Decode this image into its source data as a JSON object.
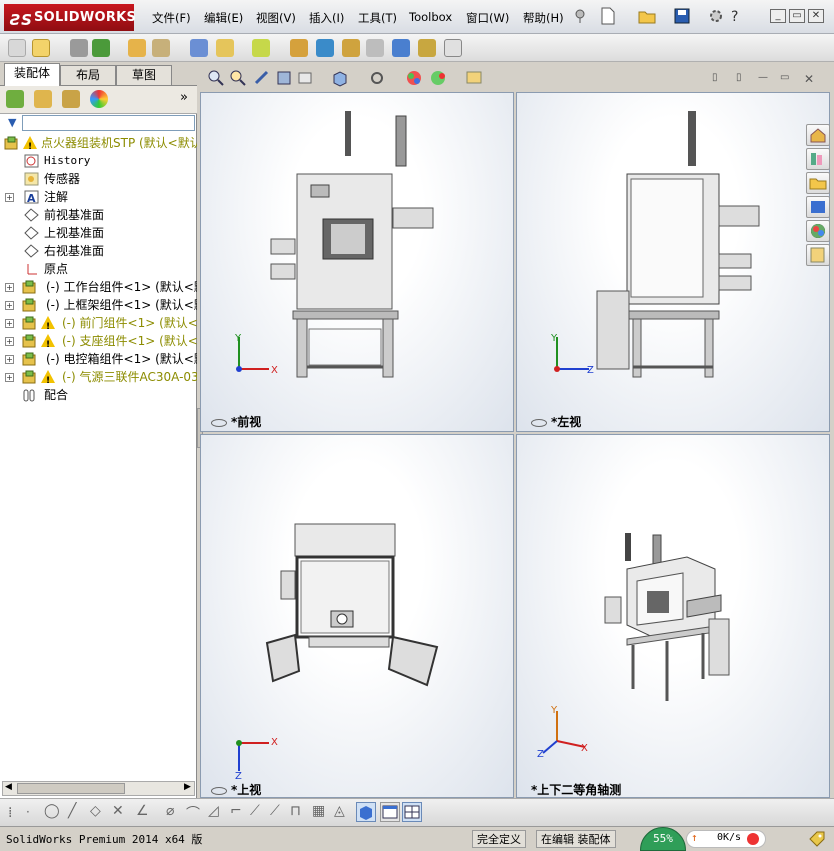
{
  "app": {
    "logo_text": "SOLIDWORKS",
    "logo_prefix": "3S"
  },
  "menu": [
    {
      "label": "文件(F)"
    },
    {
      "label": "编辑(E)"
    },
    {
      "label": "视图(V)"
    },
    {
      "label": "插入(I)"
    },
    {
      "label": "工具(T)"
    },
    {
      "label": "Toolbox"
    },
    {
      "label": "窗口(W)"
    },
    {
      "label": "帮助(H)"
    }
  ],
  "tabs": [
    {
      "label": "装配体"
    },
    {
      "label": "布局"
    },
    {
      "label": "草图"
    }
  ],
  "tree": [
    {
      "label": "点火器组装机STP  (默认<默认",
      "icon": "assembly-warning-icon",
      "color": "olive"
    },
    {
      "label": "History",
      "icon": "history-icon"
    },
    {
      "label": "传感器",
      "icon": "sensor-icon"
    },
    {
      "label": "注解",
      "icon": "annotation-icon"
    },
    {
      "label": "前视基准面",
      "icon": "plane-icon"
    },
    {
      "label": "上视基准面",
      "icon": "plane-icon"
    },
    {
      "label": "右视基准面",
      "icon": "plane-icon"
    },
    {
      "label": "原点",
      "icon": "origin-icon"
    },
    {
      "label": "(-) 工作台组件<1> (默认<默",
      "icon": "subassembly-icon"
    },
    {
      "label": "(-) 上框架组件<1> (默认<默",
      "icon": "subassembly-icon"
    },
    {
      "label": "(-) 前门组件<1> (默认<默",
      "icon": "subassembly-warning-icon",
      "color": "olive"
    },
    {
      "label": "(-) 支座组件<1> (默认<默",
      "icon": "subassembly-warning-icon",
      "color": "olive"
    },
    {
      "label": "(-) 电控箱组件<1> (默认<默",
      "icon": "subassembly-icon"
    },
    {
      "label": "(-) 气源三联件AC30A-03<",
      "icon": "subassembly-warning-icon",
      "color": "olive"
    },
    {
      "label": "配合",
      "icon": "mates-icon"
    }
  ],
  "viewports": {
    "front": "*前视",
    "left": "*左视",
    "top": "*上视",
    "iso": "*上下二等角轴测"
  },
  "axes": {
    "x": "X",
    "y": "Y",
    "z": "Z"
  },
  "status": {
    "product": "SolidWorks Premium 2014 x64 版",
    "definition": "完全定义",
    "mode": "在编辑 装配体",
    "cpu": "55%",
    "net": "0K/s"
  },
  "colors": {
    "logo_red": "#c8171e",
    "warning": "#f2c200",
    "axis_x": "#d02020",
    "axis_y": "#209020",
    "axis_z": "#2040d0"
  }
}
